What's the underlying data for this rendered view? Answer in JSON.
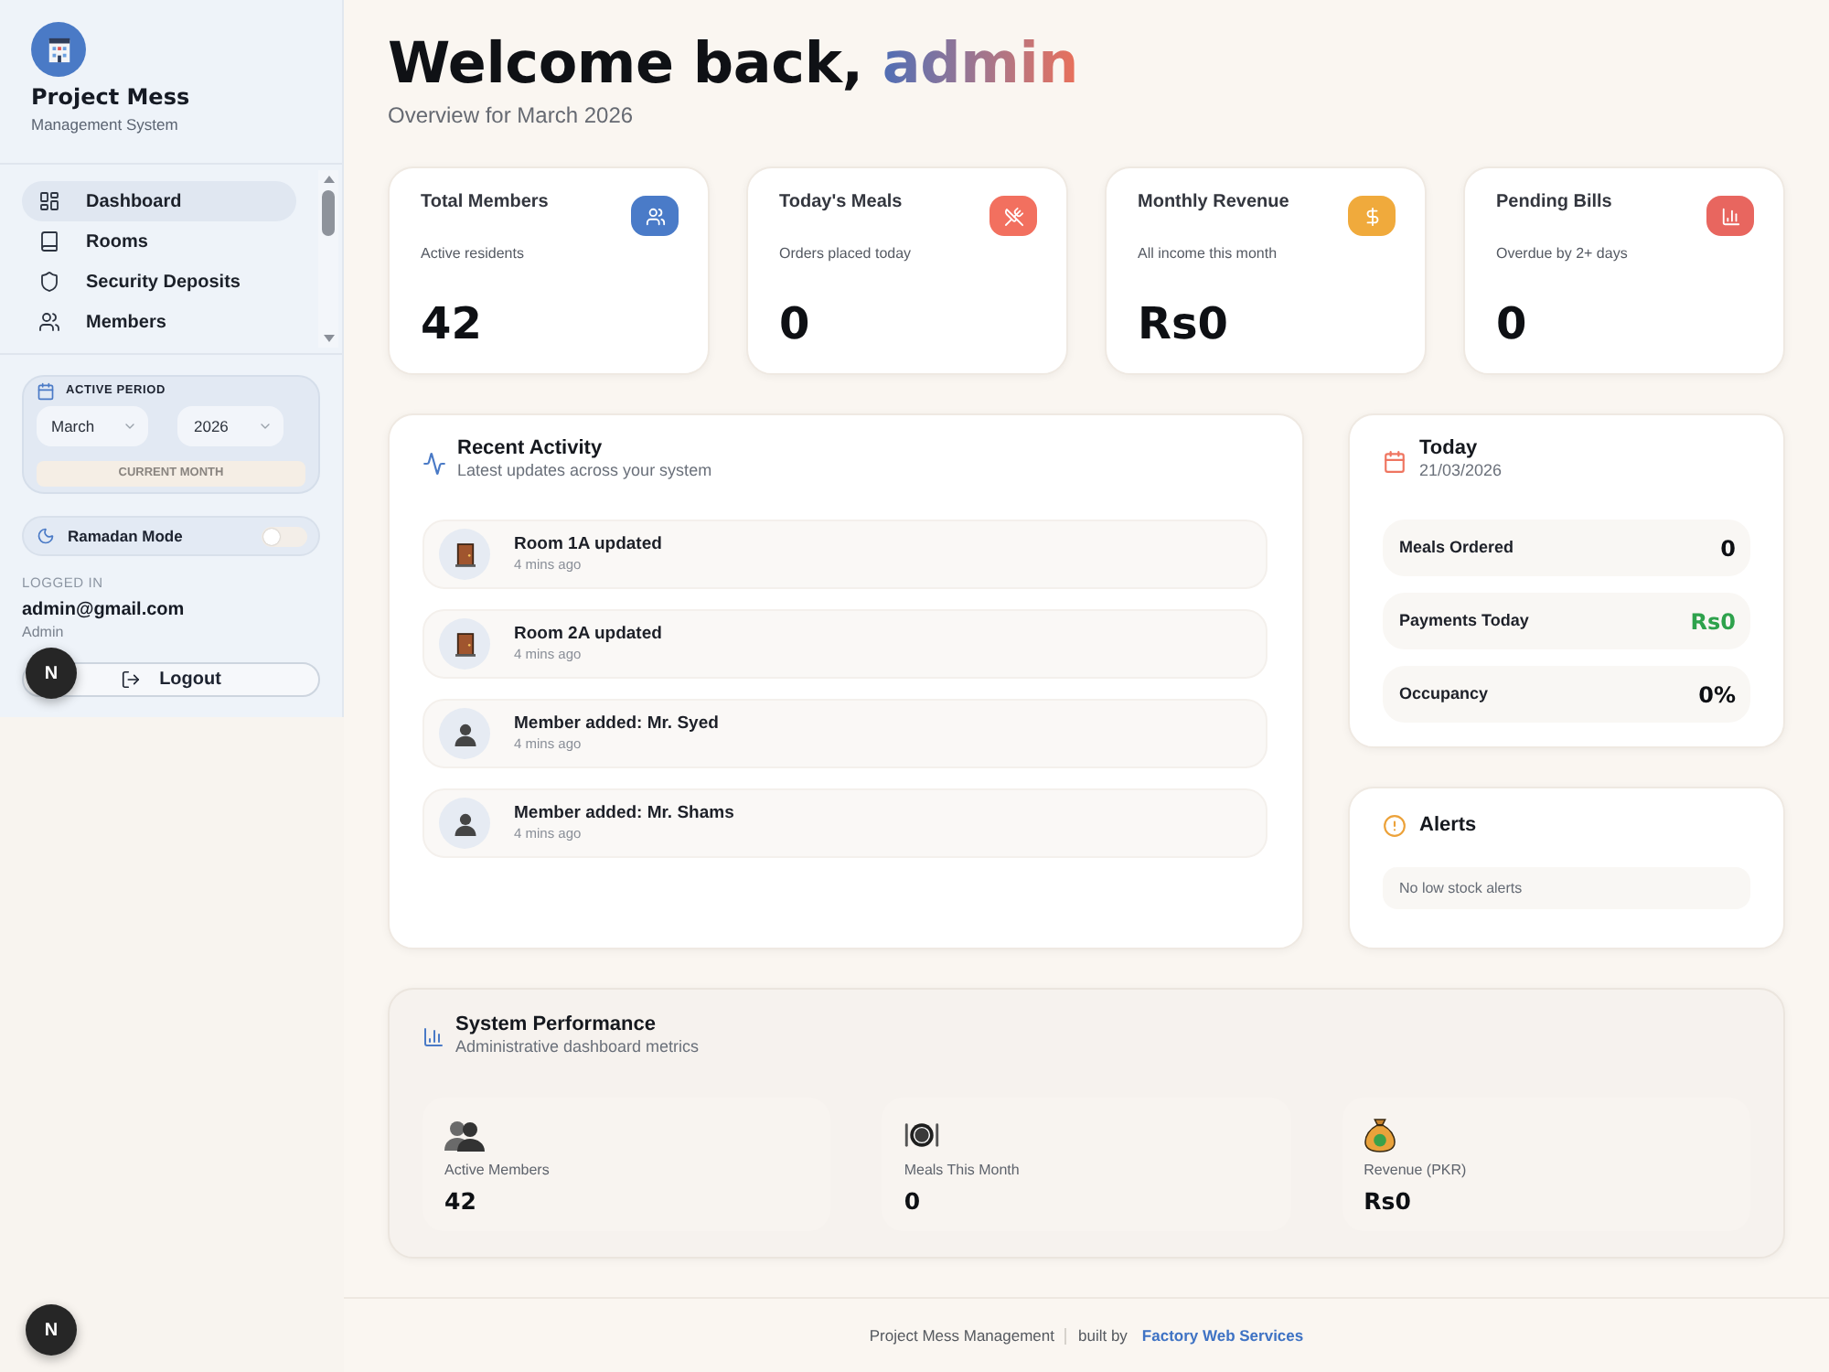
{
  "sidebar": {
    "brand": {
      "title": "Project Mess",
      "subtitle": "Management System"
    },
    "nav": [
      {
        "kind": "dashboard",
        "label": "Dashboard",
        "selected": true
      },
      {
        "kind": "rooms",
        "label": "Rooms",
        "selected": false
      },
      {
        "kind": "deposits",
        "label": "Security Deposits",
        "selected": false
      },
      {
        "kind": "members",
        "label": "Members",
        "selected": false
      }
    ],
    "period": {
      "title": "ACTIVE PERIOD",
      "month": "March",
      "year": "2026",
      "button": "CURRENT MONTH"
    },
    "ramadan_mode": {
      "label": "Ramadan Mode",
      "on": false
    },
    "account": {
      "caption": "LOGGED IN",
      "email": "admin@gmail.com",
      "role": "Admin"
    },
    "logout": "Logout"
  },
  "dev_badges": [
    {
      "label": "N"
    },
    {
      "label": "N"
    }
  ],
  "header": {
    "greeting": "Welcome back,",
    "name": "admin",
    "subtitle": "Overview for March 2026"
  },
  "stats": [
    {
      "kind": "members",
      "title": "Total Members",
      "subtitle": "Active residents",
      "value": "42",
      "color": "#4a7bc8"
    },
    {
      "kind": "meals",
      "title": "Today's Meals",
      "subtitle": "Orders placed today",
      "value": "0",
      "color": "#f2705f"
    },
    {
      "kind": "revenue",
      "title": "Monthly Revenue",
      "subtitle": "All income this month",
      "value": "Rs0",
      "color": "#f0aa3c"
    },
    {
      "kind": "bills",
      "title": "Pending Bills",
      "subtitle": "Overdue by 2+ days",
      "value": "0",
      "color": "#e8665f"
    }
  ],
  "activity": {
    "title": "Recent Activity",
    "subtitle": "Latest updates across your system",
    "items": [
      {
        "kind": "room",
        "title": "Room 1A updated",
        "time": "4 mins ago"
      },
      {
        "kind": "room",
        "title": "Room 2A updated",
        "time": "4 mins ago"
      },
      {
        "kind": "member",
        "title": "Member added: Mr. Syed",
        "time": "4 mins ago"
      },
      {
        "kind": "member",
        "title": "Member added: Mr. Shams",
        "time": "4 mins ago"
      }
    ]
  },
  "today": {
    "title": "Today",
    "date": "21/03/2026",
    "rows": [
      {
        "label": "Meals Ordered",
        "value": "0",
        "highlight": false
      },
      {
        "label": "Payments Today",
        "value": "Rs0",
        "highlight": true
      },
      {
        "label": "Occupancy",
        "value": "0%",
        "highlight": false
      }
    ]
  },
  "alerts": {
    "title": "Alerts",
    "items": [
      {
        "text": "No low stock alerts"
      }
    ]
  },
  "performance": {
    "title": "System Performance",
    "subtitle": "Administrative dashboard metrics",
    "metrics": [
      {
        "kind": "members",
        "label": "Active Members",
        "value": "42"
      },
      {
        "kind": "meals",
        "label": "Meals This Month",
        "value": "0"
      },
      {
        "kind": "revenue",
        "label": "Revenue (PKR)",
        "value": "Rs0"
      }
    ]
  },
  "footer": {
    "project": "Project Mess Management",
    "built_by": "built by",
    "company": "Factory Web Services"
  }
}
